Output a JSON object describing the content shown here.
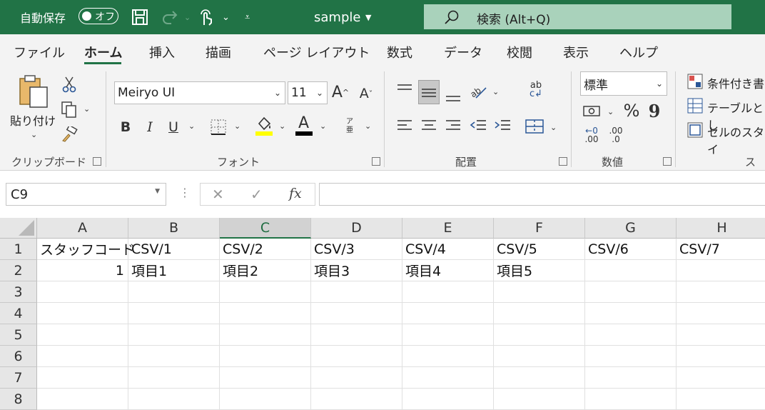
{
  "titlebar": {
    "autosave_label": "自動保存",
    "autosave_state": "オフ",
    "file_name": "sample",
    "search_placeholder": "検索 (Alt+Q)"
  },
  "menu": {
    "tabs": [
      "ファイル",
      "ホーム",
      "挿入",
      "描画",
      "ページ レイアウト",
      "数式",
      "データ",
      "校閲",
      "表示",
      "ヘルプ"
    ],
    "active": "ホーム"
  },
  "ribbon": {
    "clipboard": {
      "paste_label": "貼り付け",
      "group_label": "クリップボード"
    },
    "font": {
      "font_name": "Meiryo UI",
      "font_size": "11",
      "bold": "B",
      "italic": "I",
      "underline": "U",
      "group_label": "フォント"
    },
    "alignment": {
      "group_label": "配置",
      "wrap_label": "ab c"
    },
    "number": {
      "format": "標準",
      "percent": "%",
      "comma": "9",
      "inc_dec_1": ".00",
      "inc_dec_2": ".0",
      "group_label": "数値"
    },
    "styles": {
      "items": [
        "条件付き書",
        "テーブルとし",
        "セルのスタイ"
      ],
      "group_label": "スタ"
    },
    "colors": {
      "highlight": "#ffff00",
      "font_color": "#000000"
    }
  },
  "formula_bar": {
    "name_box": "C9",
    "fx": "fx",
    "content": ""
  },
  "sheet": {
    "columns": [
      "A",
      "B",
      "C",
      "D",
      "E",
      "F",
      "G",
      "H"
    ],
    "selected_column": "C",
    "rows": [
      "1",
      "2",
      "3",
      "4",
      "5",
      "6",
      "7",
      "8"
    ],
    "cells": [
      [
        "スタッフコード",
        "CSV/1",
        "CSV/2",
        "CSV/3",
        "CSV/4",
        "CSV/5",
        "CSV/6",
        "CSV/7"
      ],
      [
        "1",
        "項目1",
        "項目2",
        "項目3",
        "項目4",
        "項目5",
        "",
        ""
      ],
      [
        "",
        "",
        "",
        "",
        "",
        "",
        "",
        ""
      ],
      [
        "",
        "",
        "",
        "",
        "",
        "",
        "",
        ""
      ],
      [
        "",
        "",
        "",
        "",
        "",
        "",
        "",
        ""
      ],
      [
        "",
        "",
        "",
        "",
        "",
        "",
        "",
        ""
      ],
      [
        "",
        "",
        "",
        "",
        "",
        "",
        "",
        ""
      ],
      [
        "",
        "",
        "",
        "",
        "",
        "",
        "",
        ""
      ]
    ]
  },
  "theme": {
    "accent": "#217346"
  }
}
